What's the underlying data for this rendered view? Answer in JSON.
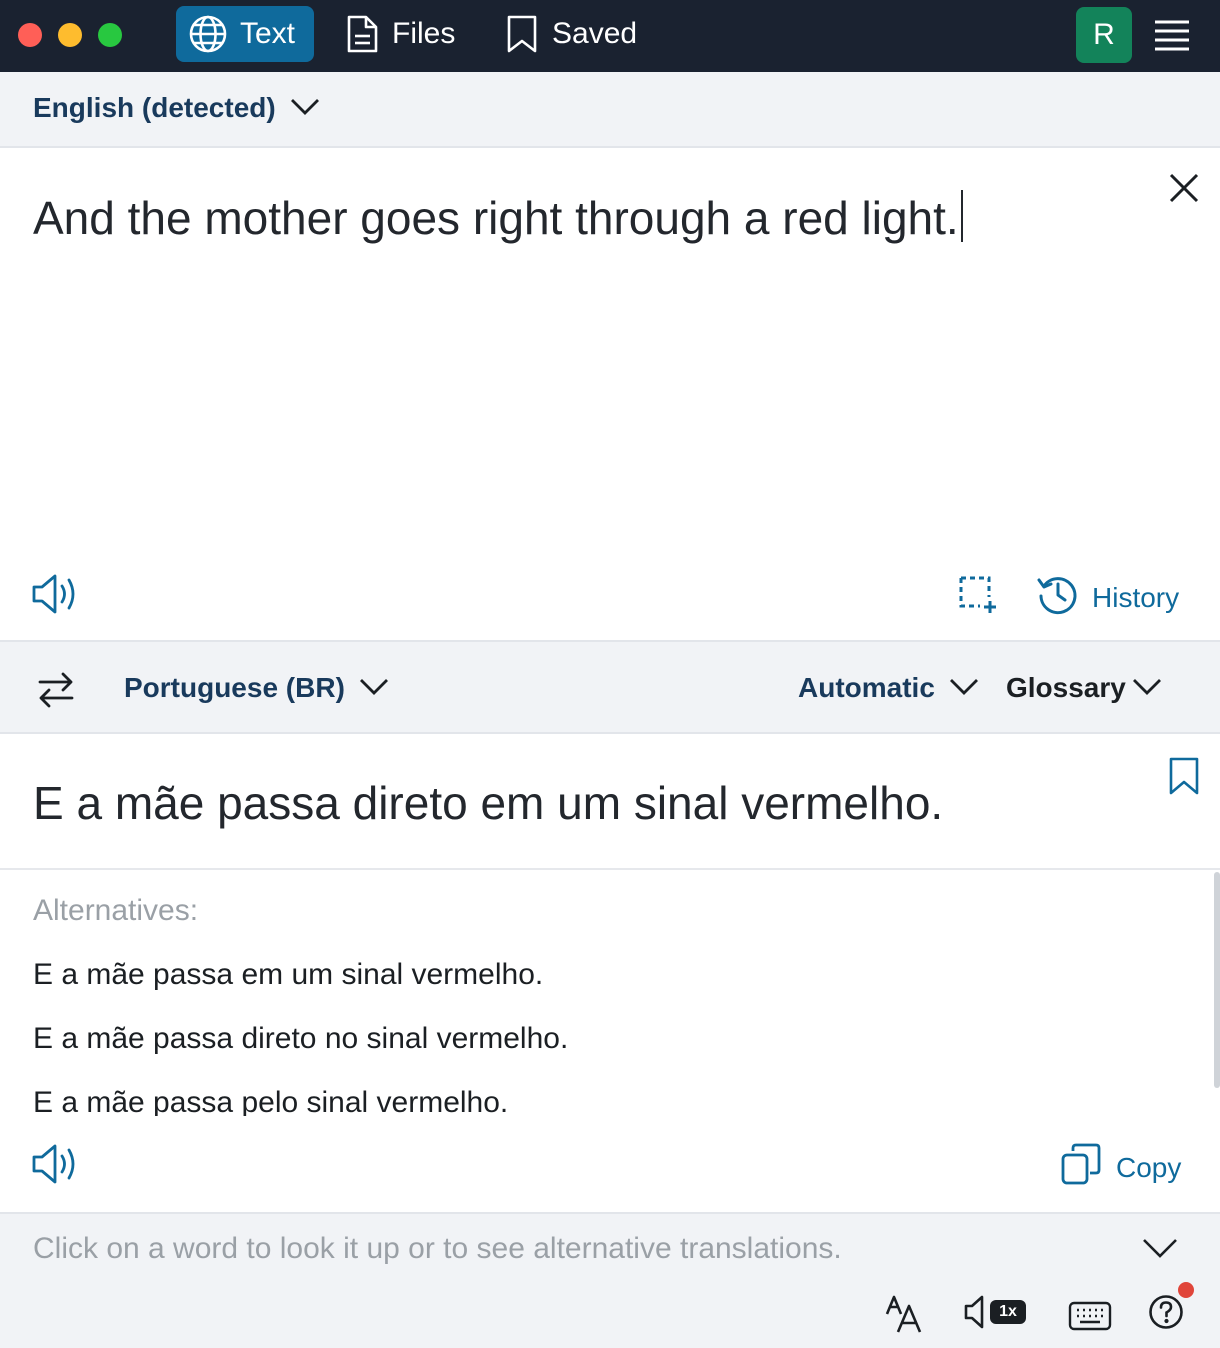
{
  "window": {
    "tabs": [
      {
        "label": "Text",
        "icon": "globe-icon",
        "active": true
      },
      {
        "label": "Files",
        "icon": "document-icon",
        "active": false
      },
      {
        "label": "Saved",
        "icon": "bookmark-icon",
        "active": false
      }
    ],
    "avatar_letter": "R",
    "colors": {
      "titlebar": "#1a2230",
      "active_tab": "#0f6a9c",
      "avatar": "#13835a",
      "accent": "#0f6a9c"
    }
  },
  "source": {
    "language": "English (detected)",
    "text": "And the mother goes right through a red light.",
    "history_label": "History"
  },
  "target": {
    "language": "Portuguese (BR)",
    "formality": "Automatic",
    "glossary": "Glossary",
    "text": "E a mãe passa direto em um sinal vermelho.",
    "alternatives_title": "Alternatives:",
    "alternatives": [
      "E a mãe passa em um sinal vermelho.",
      "E a mãe passa direto no sinal vermelho.",
      "E a mãe passa pelo sinal vermelho."
    ],
    "copy_label": "Copy"
  },
  "dictionary": {
    "hint": "Click on a word to look it up or to see alternative translations.",
    "speed_label": "1x"
  }
}
